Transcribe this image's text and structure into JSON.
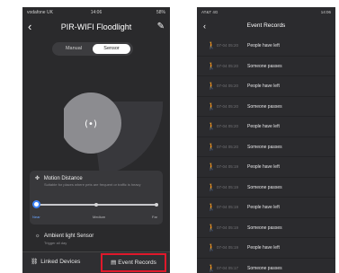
{
  "left_screen": {
    "status_bar": {
      "carrier": "vodafone UK",
      "time": "14:06",
      "battery": "58%"
    },
    "header": {
      "title": "PIR-WIFI Floodlight",
      "back_icon": "chevron-left-icon",
      "edit_icon": "pencil-icon"
    },
    "mode_toggle": {
      "options": [
        "Manual",
        "Sensor"
      ],
      "selected": "Sensor"
    },
    "radar": {
      "icon": "motion-signal-icon",
      "glyph": "(•)"
    },
    "motion_distance": {
      "title": "Motion Distance",
      "description": "Suitable for places where pets are frequent or traffic is heavy",
      "labels": [
        "Near",
        "Medium",
        "Far"
      ],
      "selected": "Near"
    },
    "ambient_light": {
      "title": "Ambient light Sensor",
      "description": "Trigger all day"
    },
    "bottom_bar": {
      "linked_devices": "Linked Devices",
      "event_records": "Event Records"
    },
    "colors": {
      "highlight": "#e0192b",
      "slider_accent": "#3b82f6"
    }
  },
  "right_screen": {
    "status_bar": {
      "left": "AT&T 4G",
      "right": "14:06"
    },
    "header": {
      "title": "Event Records"
    },
    "records": [
      {
        "time": "07-04 05:20",
        "text": "People have left"
      },
      {
        "time": "07-04 05:20",
        "text": "Someone passes"
      },
      {
        "time": "07-04 05:20",
        "text": "People have left"
      },
      {
        "time": "07-04 05:20",
        "text": "Someone passes"
      },
      {
        "time": "07-04 05:20",
        "text": "People have left"
      },
      {
        "time": "07-04 05:20",
        "text": "Someone passes"
      },
      {
        "time": "07-04 05:19",
        "text": "People have left"
      },
      {
        "time": "07-04 05:19",
        "text": "Someone passes"
      },
      {
        "time": "07-04 05:19",
        "text": "People have left"
      },
      {
        "time": "07-04 05:19",
        "text": "Someone passes"
      },
      {
        "time": "07-04 05:19",
        "text": "People have left"
      },
      {
        "time": "07-04 05:17",
        "text": "Someone passes"
      }
    ]
  }
}
